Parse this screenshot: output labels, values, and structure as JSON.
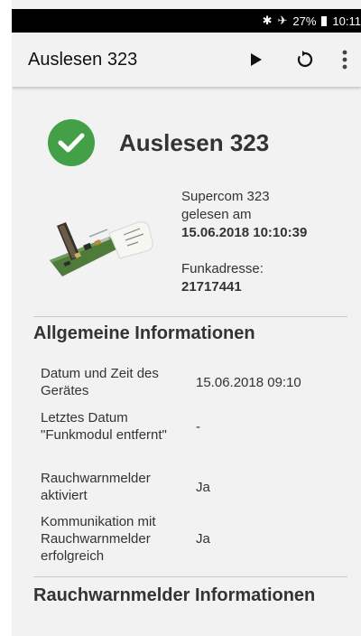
{
  "status_bar": {
    "battery": "27%",
    "time": "10:11",
    "icons": [
      "bluetooth-icon",
      "airplane-icon",
      "battery-icon"
    ]
  },
  "app_bar": {
    "title": "Auslesen 323",
    "actions": [
      "play-icon",
      "refresh-icon",
      "more-vert-icon"
    ]
  },
  "result": {
    "title": "Auslesen 323",
    "status_icon": "check-circle-icon",
    "status_color": "#43a047"
  },
  "device": {
    "name_line": "Supercom 323",
    "read_line": "gelesen am",
    "read_datetime": "15.06.2018 10:10:39",
    "radio_address_label": "Funkadresse:",
    "radio_address": "21717441"
  },
  "general": {
    "title": "Allgemeine Informationen",
    "rows": [
      {
        "label": "Datum und Zeit des Gerätes",
        "value": "15.06.2018 09:10"
      },
      {
        "label": "Letztes Datum \"Funkmodul entfernt\"",
        "value": "-"
      },
      {
        "label": "Rauchwarnmelder aktiviert",
        "value": "Ja"
      },
      {
        "label": "Kommunikation mit Rauchwarnmelder erfolgreich",
        "value": "Ja"
      }
    ]
  },
  "smoke": {
    "title": "Rauchwarnmelder Informationen"
  }
}
